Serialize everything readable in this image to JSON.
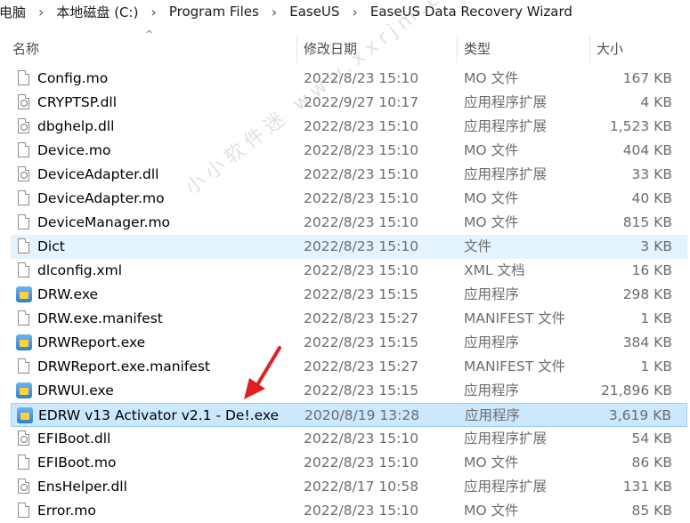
{
  "breadcrumb": [
    "电脑",
    "本地磁盘 (C:)",
    "Program Files",
    "EaseUS",
    "EaseUS Data Recovery Wizard"
  ],
  "columns": {
    "name": "名称",
    "date": "修改日期",
    "type": "类型",
    "size": "大小"
  },
  "files": [
    {
      "name": "Config.mo",
      "date": "2022/8/23 15:10",
      "type": "MO 文件",
      "size": "167 KB",
      "icon": "file-icon"
    },
    {
      "name": "CRYPTSP.dll",
      "date": "2022/9/27 10:17",
      "type": "应用程序扩展",
      "size": "4 KB",
      "icon": "dll-icon"
    },
    {
      "name": "dbghelp.dll",
      "date": "2022/8/23 15:10",
      "type": "应用程序扩展",
      "size": "1,523 KB",
      "icon": "dll-icon"
    },
    {
      "name": "Device.mo",
      "date": "2022/8/23 15:10",
      "type": "MO 文件",
      "size": "404 KB",
      "icon": "file-icon"
    },
    {
      "name": "DeviceAdapter.dll",
      "date": "2022/8/23 15:10",
      "type": "应用程序扩展",
      "size": "33 KB",
      "icon": "dll-icon"
    },
    {
      "name": "DeviceAdapter.mo",
      "date": "2022/8/23 15:10",
      "type": "MO 文件",
      "size": "40 KB",
      "icon": "file-icon"
    },
    {
      "name": "DeviceManager.mo",
      "date": "2022/8/23 15:10",
      "type": "MO 文件",
      "size": "815 KB",
      "icon": "file-icon"
    },
    {
      "name": "Dict",
      "date": "2022/8/23 15:10",
      "type": "文件",
      "size": "3 KB",
      "icon": "file-icon"
    },
    {
      "name": "dlconfig.xml",
      "date": "2022/8/23 15:10",
      "type": "XML 文档",
      "size": "16 KB",
      "icon": "file-icon"
    },
    {
      "name": "DRW.exe",
      "date": "2022/8/23 15:15",
      "type": "应用程序",
      "size": "298 KB",
      "icon": "exe-icon"
    },
    {
      "name": "DRW.exe.manifest",
      "date": "2022/8/23 15:27",
      "type": "MANIFEST 文件",
      "size": "1 KB",
      "icon": "file-icon"
    },
    {
      "name": "DRWReport.exe",
      "date": "2022/8/23 15:15",
      "type": "应用程序",
      "size": "384 KB",
      "icon": "exe-icon"
    },
    {
      "name": "DRWReport.exe.manifest",
      "date": "2022/8/23 15:27",
      "type": "MANIFEST 文件",
      "size": "1 KB",
      "icon": "file-icon"
    },
    {
      "name": "DRWUI.exe",
      "date": "2022/8/23 15:15",
      "type": "应用程序",
      "size": "21,896 KB",
      "icon": "exe-icon"
    },
    {
      "name": "EDRW v13 Activator v2.1 - De!.exe",
      "date": "2020/8/19 13:28",
      "type": "应用程序",
      "size": "3,619 KB",
      "icon": "exe-icon"
    },
    {
      "name": "EFIBoot.dll",
      "date": "2022/8/23 15:10",
      "type": "应用程序扩展",
      "size": "54 KB",
      "icon": "dll-icon"
    },
    {
      "name": "EFIBoot.mo",
      "date": "2022/8/23 15:10",
      "type": "MO 文件",
      "size": "86 KB",
      "icon": "file-icon"
    },
    {
      "name": "EnsHelper.dll",
      "date": "2022/8/17 10:58",
      "type": "应用程序扩展",
      "size": "131 KB",
      "icon": "dll-icon"
    },
    {
      "name": "Error.mo",
      "date": "2022/8/23 15:10",
      "type": "MO 文件",
      "size": "85 KB",
      "icon": "file-icon"
    }
  ],
  "hover_row": 7,
  "selected_row": 14,
  "watermark": "小小软件迷 www.xxrjm.com",
  "colors": {
    "selected_bg": "#cce8ff",
    "hover_bg": "#e5f3ff",
    "arrow": "#e02020"
  }
}
